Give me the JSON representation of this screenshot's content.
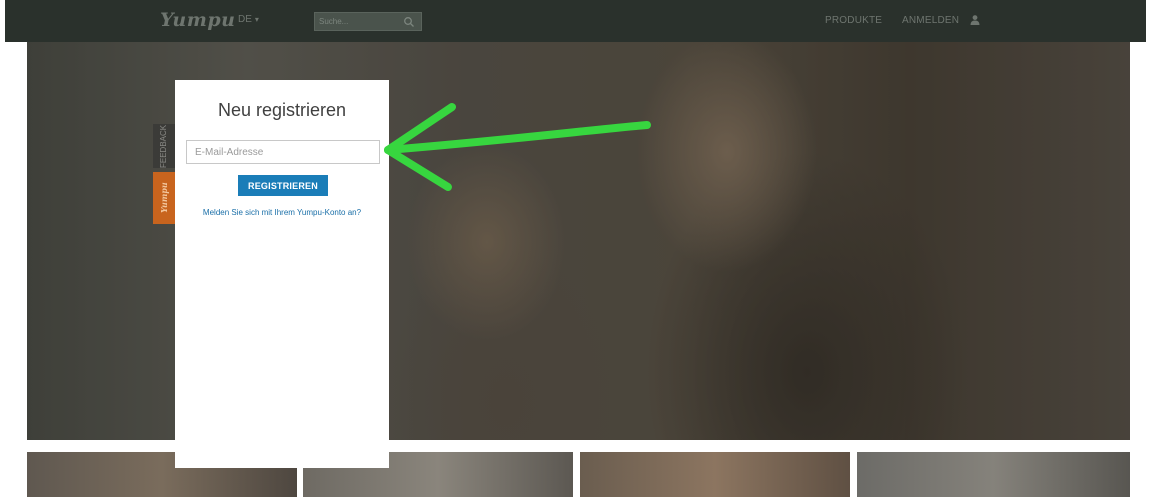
{
  "header": {
    "logo": "Yumpu",
    "language": "DE",
    "search_placeholder": "Suche...",
    "nav": [
      "PRODUKTE",
      "ANMELDEN"
    ],
    "user_icon": "user-icon",
    "search_icon": "search-icon"
  },
  "side_tabs": {
    "feedback": "FEEDBACK",
    "yumpu": "Yumpu"
  },
  "modal": {
    "title": "Neu registrieren",
    "email_placeholder": "E-Mail-Adresse",
    "register_label": "REGISTRIEREN",
    "login_link": "Melden Sie sich mit Ihrem Yumpu-Konto an?"
  },
  "annotation": {
    "arrow_color": "#37d63f"
  },
  "colors": {
    "topbar": "#2a312c",
    "button": "#1a7db8",
    "link": "#1a6fa8",
    "yumpu_tab": "#c8641e"
  }
}
